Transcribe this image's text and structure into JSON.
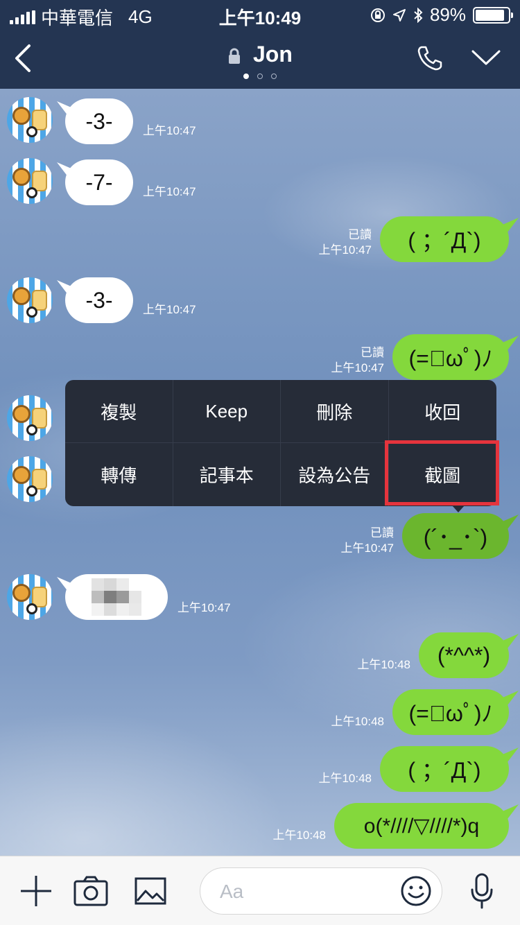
{
  "status_bar": {
    "carrier": "中華電信",
    "network": "4G",
    "time": "上午10:49",
    "battery": "89%",
    "battery_level": 0.89
  },
  "header": {
    "title": "Jon",
    "page_dots": 3,
    "active_dot": 0
  },
  "messages": [
    {
      "dir": "in",
      "text": "-3-",
      "time": "上午10:47"
    },
    {
      "dir": "in",
      "text": "-7-",
      "time": "上午10:47"
    },
    {
      "dir": "out",
      "text": "( ；´Д`)",
      "read": "已讀",
      "time": "上午10:47"
    },
    {
      "dir": "in",
      "text": "-3-",
      "time": "上午10:47"
    },
    {
      "dir": "out",
      "text": "(=ﾟωﾟ)ﾉ",
      "read": "已讀",
      "time": "上午10:47"
    },
    {
      "dir": "out",
      "text": "(´･_･`)",
      "read": "已讀",
      "time": "上午10:47"
    },
    {
      "dir": "in",
      "text": "",
      "time": "上午10:47"
    },
    {
      "dir": "out",
      "text": "(*^^*)",
      "time": "上午10:48"
    },
    {
      "dir": "out",
      "text": "(=ﾟωﾟ)ﾉ",
      "time": "上午10:48"
    },
    {
      "dir": "out",
      "text": "( ；´Д`)",
      "time": "上午10:48"
    },
    {
      "dir": "out",
      "text": "o(*////▽////*)q",
      "time": "上午10:48"
    }
  ],
  "context_menu": {
    "items": [
      "複製",
      "Keep",
      "刪除",
      "收回",
      "轉傳",
      "記事本",
      "設為公告",
      "截圖"
    ],
    "highlighted": "截圖",
    "highlight_color": "#e5343d"
  },
  "input_bar": {
    "placeholder": "Aa"
  },
  "colors": {
    "header_bg": "#243552",
    "out_bubble": "#84d83c",
    "in_bubble": "#ffffff",
    "menu_bg": "#262c38"
  }
}
